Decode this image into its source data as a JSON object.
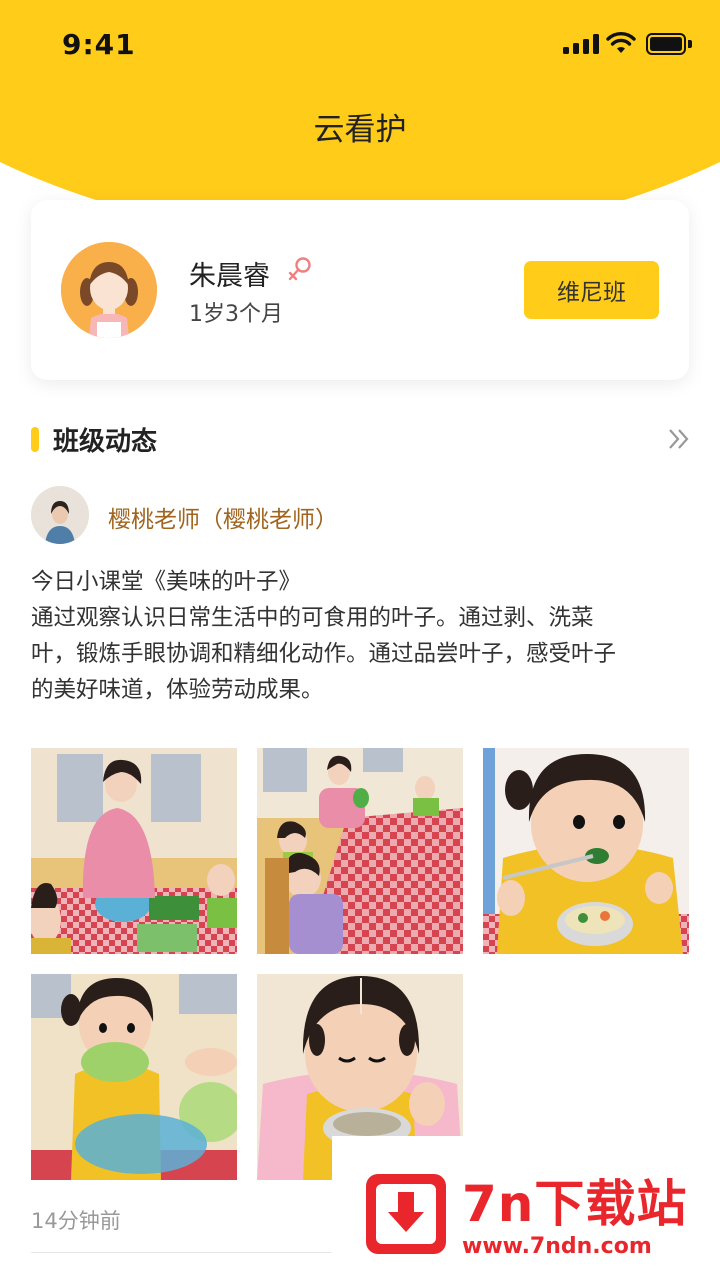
{
  "status_bar": {
    "time": "9:41"
  },
  "app": {
    "title": "云看护"
  },
  "child": {
    "name": "朱晨睿",
    "age": "1岁3个月",
    "class_label": "维尼班",
    "gender_icon": "female-icon"
  },
  "section": {
    "title": "班级动态",
    "more_icon": "double-chevron-right-icon"
  },
  "post": {
    "teacher": "樱桃老师（樱桃老师）",
    "text_lines": [
      "今日小课堂《美味的叶子》",
      "通过观察认识日常生活中的可食用的叶子。通过剥、洗菜",
      "叶，锻炼手眼协调和精细化动作。通过品尝叶子，感受叶子",
      "的美好味道，体验劳动成果。"
    ],
    "photo_count": 5,
    "time": "14分钟前"
  },
  "watermark": {
    "title": "7n下载站",
    "url": "www.7ndn.com"
  },
  "colors": {
    "accent": "#FFCC1A",
    "teacher_name": "#A0641E",
    "watermark": "#E8262B"
  }
}
